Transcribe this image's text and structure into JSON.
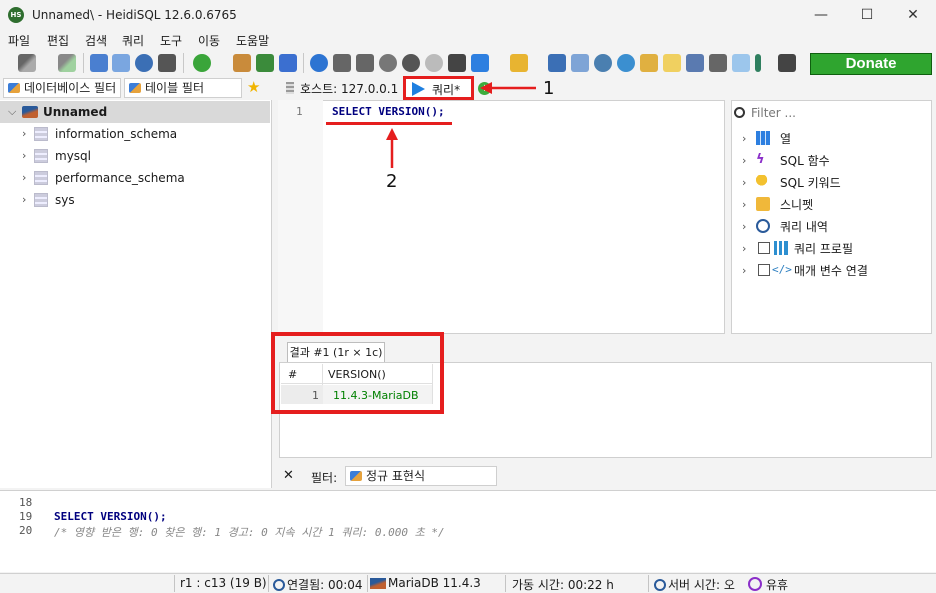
{
  "window": {
    "title": "Unnamed\\ - HeidiSQL 12.6.0.6765",
    "app_icon_text": "HS",
    "minimize": "—",
    "maximize": "☐",
    "close": "✕"
  },
  "menu": [
    "파일",
    "편집",
    "검색",
    "쿼리",
    "도구",
    "이동",
    "도움말"
  ],
  "toolbar": {
    "donate_label": "Donate"
  },
  "left": {
    "db_filter_placeholder": "데이터베이스 필터",
    "table_filter_placeholder": "테이블 필터",
    "session": "Unnamed",
    "databases": [
      "information_schema",
      "mysql",
      "performance_schema",
      "sys"
    ]
  },
  "tabs": {
    "host": "호스트: 127.0.0.1",
    "query": "쿼리*"
  },
  "editor": {
    "line": "1",
    "sql": "SELECT VERSION();"
  },
  "helper": {
    "filter_placeholder": "Filter ...",
    "items": [
      "열",
      "SQL 함수",
      "SQL 키워드",
      "스니펫",
      "쿼리 내역",
      "쿼리 프로필",
      "매개 변수 연결"
    ]
  },
  "results": {
    "tab_label": "결과 #1 (1r × 1c)",
    "columns": [
      "#",
      "VERSION()"
    ],
    "rows": [
      [
        "1",
        "11.4.3-MariaDB"
      ]
    ]
  },
  "result_filter": {
    "close": "✕",
    "label": "필터:",
    "placeholder": "정규 표현식"
  },
  "log": {
    "lines": [
      "18",
      "19",
      "20"
    ],
    "sql": "SELECT VERSION();",
    "comment": "/* 영향 받은 행: 0  찾은 행: 1  경고: 0  지속 시간 1 쿼리: 0.000 초 */"
  },
  "status": {
    "position": "r1 : c13 (19 B)",
    "connected": "연결됨: 00:04",
    "server": "MariaDB 11.4.3",
    "uptime": "가동 시간: 00:22 h",
    "server_time": "서버 시간: 오",
    "idle": "유휴"
  },
  "annotations": {
    "one": "1",
    "two": "2"
  },
  "colors": {
    "accent_red": "#e51e1e",
    "donate_green": "#2fa52f",
    "sql_keyword": "#00007f",
    "result_value": "#008000"
  }
}
